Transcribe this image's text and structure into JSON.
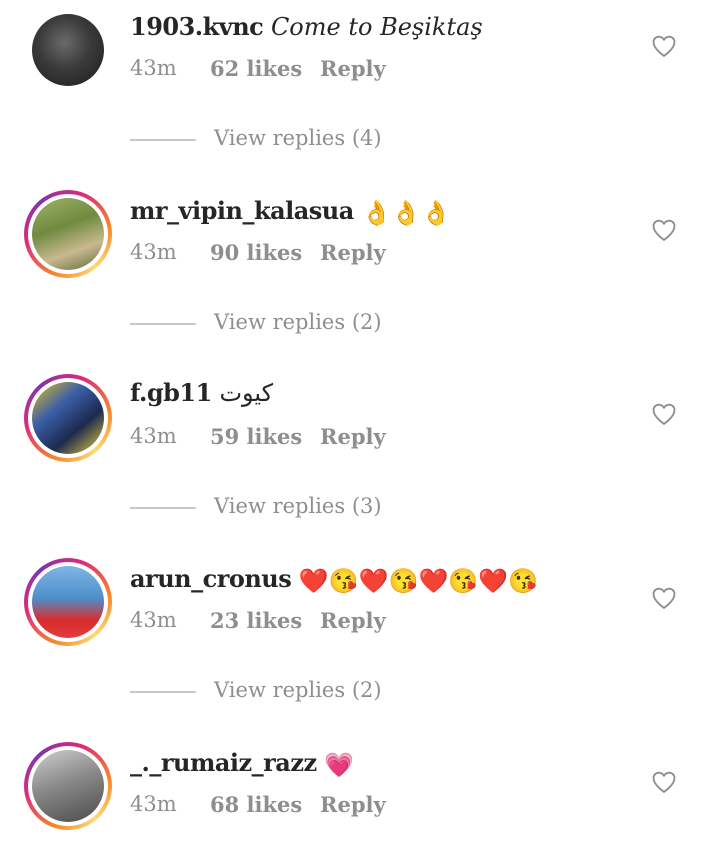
{
  "comments": [
    {
      "username": "1903.kvnc",
      "text": "Come to Beşiktaş",
      "emojis": "",
      "time": "43m",
      "likes": "62 likes",
      "reply": "Reply",
      "avatar_ring": false,
      "view_replies": "View replies (4)"
    },
    {
      "username": "mr_vipin_kalasua",
      "text": "",
      "emojis": "👌👌👌",
      "time": "43m",
      "likes": "90 likes",
      "reply": "Reply",
      "avatar_ring": true,
      "view_replies": "View replies (2)"
    },
    {
      "username": "f.gb11",
      "text": "كيوت",
      "emojis": "",
      "time": "43m",
      "likes": "59 likes",
      "reply": "Reply",
      "avatar_ring": true,
      "view_replies": "View replies (3)"
    },
    {
      "username": "arun_cronus",
      "text": "",
      "emojis": "❤️😘❤️😘❤️😘❤️😘",
      "time": "43m",
      "likes": "23 likes",
      "reply": "Reply",
      "avatar_ring": true,
      "view_replies": "View replies (2)"
    },
    {
      "username": "_._rumaiz_razz",
      "text": "",
      "emojis": "💗",
      "time": "43m",
      "likes": "68 likes",
      "reply": "Reply",
      "avatar_ring": true,
      "view_replies": ""
    }
  ],
  "icons": {
    "like": "heart-outline-icon"
  },
  "colors": {
    "text": "#262626",
    "muted": "#8e8e8e",
    "story_ring_start": "#f58529",
    "story_ring_end": "#dd2a7b"
  }
}
